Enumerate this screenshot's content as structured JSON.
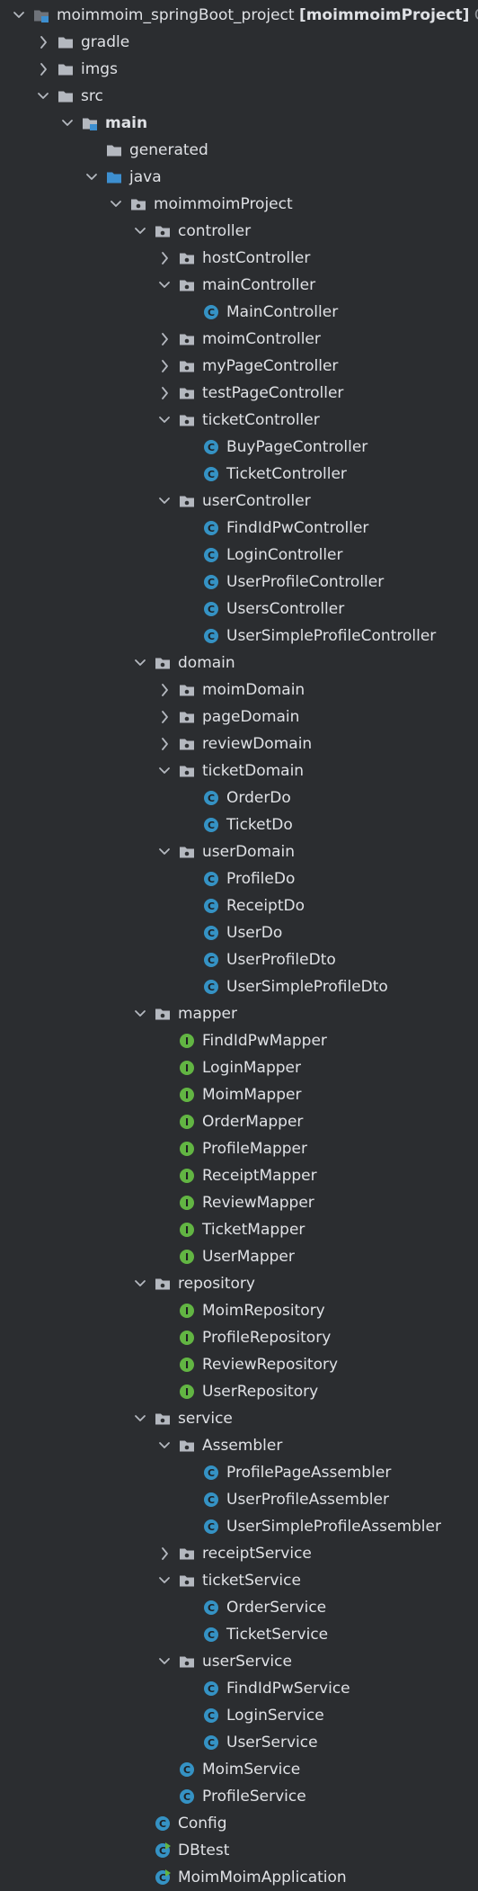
{
  "colors": {
    "background": "#2b2d30",
    "text": "#dfe1e5",
    "muted_text": "#8c8f94",
    "folder": "#b4b8bf",
    "source_folder": "#3d8fd0",
    "class_icon": "#3592c4",
    "interface_icon": "#62b543",
    "chevron": "#b4b8bf"
  },
  "tree": [
    {
      "depth": 0,
      "state": "expanded",
      "icon": "module-icon",
      "label": "moimmoim_springBoot_project",
      "suffix": "[moimmoimProject]",
      "extra": "C:\\"
    },
    {
      "depth": 1,
      "state": "collapsed",
      "icon": "folder-icon",
      "label": "gradle"
    },
    {
      "depth": 1,
      "state": "collapsed",
      "icon": "folder-icon",
      "label": "imgs"
    },
    {
      "depth": 1,
      "state": "expanded",
      "icon": "folder-icon",
      "label": "src"
    },
    {
      "depth": 2,
      "state": "expanded",
      "icon": "module-folder-icon",
      "label": "main",
      "bold": true
    },
    {
      "depth": 3,
      "state": "none",
      "icon": "folder-icon",
      "label": "generated"
    },
    {
      "depth": 3,
      "state": "expanded",
      "icon": "source-folder-icon",
      "label": "java"
    },
    {
      "depth": 4,
      "state": "expanded",
      "icon": "package-icon",
      "label": "moimmoimProject"
    },
    {
      "depth": 5,
      "state": "expanded",
      "icon": "package-icon",
      "label": "controller"
    },
    {
      "depth": 6,
      "state": "collapsed",
      "icon": "package-icon",
      "label": "hostController"
    },
    {
      "depth": 6,
      "state": "expanded",
      "icon": "package-icon",
      "label": "mainController"
    },
    {
      "depth": 7,
      "state": "none",
      "icon": "class-icon",
      "label": "MainController"
    },
    {
      "depth": 6,
      "state": "collapsed",
      "icon": "package-icon",
      "label": "moimController"
    },
    {
      "depth": 6,
      "state": "collapsed",
      "icon": "package-icon",
      "label": "myPageController"
    },
    {
      "depth": 6,
      "state": "collapsed",
      "icon": "package-icon",
      "label": "testPageController"
    },
    {
      "depth": 6,
      "state": "expanded",
      "icon": "package-icon",
      "label": "ticketController"
    },
    {
      "depth": 7,
      "state": "none",
      "icon": "class-icon",
      "label": "BuyPageController"
    },
    {
      "depth": 7,
      "state": "none",
      "icon": "class-icon",
      "label": "TicketController"
    },
    {
      "depth": 6,
      "state": "expanded",
      "icon": "package-icon",
      "label": "userController"
    },
    {
      "depth": 7,
      "state": "none",
      "icon": "class-icon",
      "label": "FindIdPwController"
    },
    {
      "depth": 7,
      "state": "none",
      "icon": "class-icon",
      "label": "LoginController"
    },
    {
      "depth": 7,
      "state": "none",
      "icon": "class-icon",
      "label": "UserProfileController"
    },
    {
      "depth": 7,
      "state": "none",
      "icon": "class-icon",
      "label": "UsersController"
    },
    {
      "depth": 7,
      "state": "none",
      "icon": "class-icon",
      "label": "UserSimpleProfileController"
    },
    {
      "depth": 5,
      "state": "expanded",
      "icon": "package-icon",
      "label": "domain"
    },
    {
      "depth": 6,
      "state": "collapsed",
      "icon": "package-icon",
      "label": "moimDomain"
    },
    {
      "depth": 6,
      "state": "collapsed",
      "icon": "package-icon",
      "label": "pageDomain"
    },
    {
      "depth": 6,
      "state": "collapsed",
      "icon": "package-icon",
      "label": "reviewDomain"
    },
    {
      "depth": 6,
      "state": "expanded",
      "icon": "package-icon",
      "label": "ticketDomain"
    },
    {
      "depth": 7,
      "state": "none",
      "icon": "class-icon",
      "label": "OrderDo"
    },
    {
      "depth": 7,
      "state": "none",
      "icon": "class-icon",
      "label": "TicketDo"
    },
    {
      "depth": 6,
      "state": "expanded",
      "icon": "package-icon",
      "label": "userDomain"
    },
    {
      "depth": 7,
      "state": "none",
      "icon": "class-icon",
      "label": "ProfileDo"
    },
    {
      "depth": 7,
      "state": "none",
      "icon": "class-icon",
      "label": "ReceiptDo"
    },
    {
      "depth": 7,
      "state": "none",
      "icon": "class-icon",
      "label": "UserDo"
    },
    {
      "depth": 7,
      "state": "none",
      "icon": "class-icon",
      "label": "UserProfileDto"
    },
    {
      "depth": 7,
      "state": "none",
      "icon": "class-icon",
      "label": "UserSimpleProfileDto"
    },
    {
      "depth": 5,
      "state": "expanded",
      "icon": "package-icon",
      "label": "mapper"
    },
    {
      "depth": 6,
      "state": "none",
      "icon": "interface-icon",
      "label": "FindIdPwMapper"
    },
    {
      "depth": 6,
      "state": "none",
      "icon": "interface-icon",
      "label": "LoginMapper"
    },
    {
      "depth": 6,
      "state": "none",
      "icon": "interface-icon",
      "label": "MoimMapper"
    },
    {
      "depth": 6,
      "state": "none",
      "icon": "interface-icon",
      "label": "OrderMapper"
    },
    {
      "depth": 6,
      "state": "none",
      "icon": "interface-icon",
      "label": "ProfileMapper"
    },
    {
      "depth": 6,
      "state": "none",
      "icon": "interface-icon",
      "label": "ReceiptMapper"
    },
    {
      "depth": 6,
      "state": "none",
      "icon": "interface-icon",
      "label": "ReviewMapper"
    },
    {
      "depth": 6,
      "state": "none",
      "icon": "interface-icon",
      "label": "TicketMapper"
    },
    {
      "depth": 6,
      "state": "none",
      "icon": "interface-icon",
      "label": "UserMapper"
    },
    {
      "depth": 5,
      "state": "expanded",
      "icon": "package-icon",
      "label": "repository"
    },
    {
      "depth": 6,
      "state": "none",
      "icon": "interface-icon",
      "label": "MoimRepository"
    },
    {
      "depth": 6,
      "state": "none",
      "icon": "interface-icon",
      "label": "ProfileRepository"
    },
    {
      "depth": 6,
      "state": "none",
      "icon": "interface-icon",
      "label": "ReviewRepository"
    },
    {
      "depth": 6,
      "state": "none",
      "icon": "interface-icon",
      "label": "UserRepository"
    },
    {
      "depth": 5,
      "state": "expanded",
      "icon": "package-icon",
      "label": "service"
    },
    {
      "depth": 6,
      "state": "expanded",
      "icon": "package-icon",
      "label": "Assembler"
    },
    {
      "depth": 7,
      "state": "none",
      "icon": "class-icon",
      "label": "ProfilePageAssembler"
    },
    {
      "depth": 7,
      "state": "none",
      "icon": "class-icon",
      "label": "UserProfileAssembler"
    },
    {
      "depth": 7,
      "state": "none",
      "icon": "class-icon",
      "label": "UserSimpleProfileAssembler"
    },
    {
      "depth": 6,
      "state": "collapsed",
      "icon": "package-icon",
      "label": "receiptService"
    },
    {
      "depth": 6,
      "state": "expanded",
      "icon": "package-icon",
      "label": "ticketService"
    },
    {
      "depth": 7,
      "state": "none",
      "icon": "class-icon",
      "label": "OrderService"
    },
    {
      "depth": 7,
      "state": "none",
      "icon": "class-icon",
      "label": "TicketService"
    },
    {
      "depth": 6,
      "state": "expanded",
      "icon": "package-icon",
      "label": "userService"
    },
    {
      "depth": 7,
      "state": "none",
      "icon": "class-icon",
      "label": "FindIdPwService"
    },
    {
      "depth": 7,
      "state": "none",
      "icon": "class-icon",
      "label": "LoginService"
    },
    {
      "depth": 7,
      "state": "none",
      "icon": "class-icon",
      "label": "UserService"
    },
    {
      "depth": 6,
      "state": "none",
      "icon": "class-icon",
      "label": "MoimService"
    },
    {
      "depth": 6,
      "state": "none",
      "icon": "class-icon",
      "label": "ProfileService"
    },
    {
      "depth": 5,
      "state": "none",
      "icon": "class-icon",
      "label": "Config"
    },
    {
      "depth": 5,
      "state": "none",
      "icon": "runnable-class-icon",
      "label": "DBtest"
    },
    {
      "depth": 5,
      "state": "none",
      "icon": "runnable-class-icon",
      "label": "MoimMoimApplication"
    }
  ]
}
